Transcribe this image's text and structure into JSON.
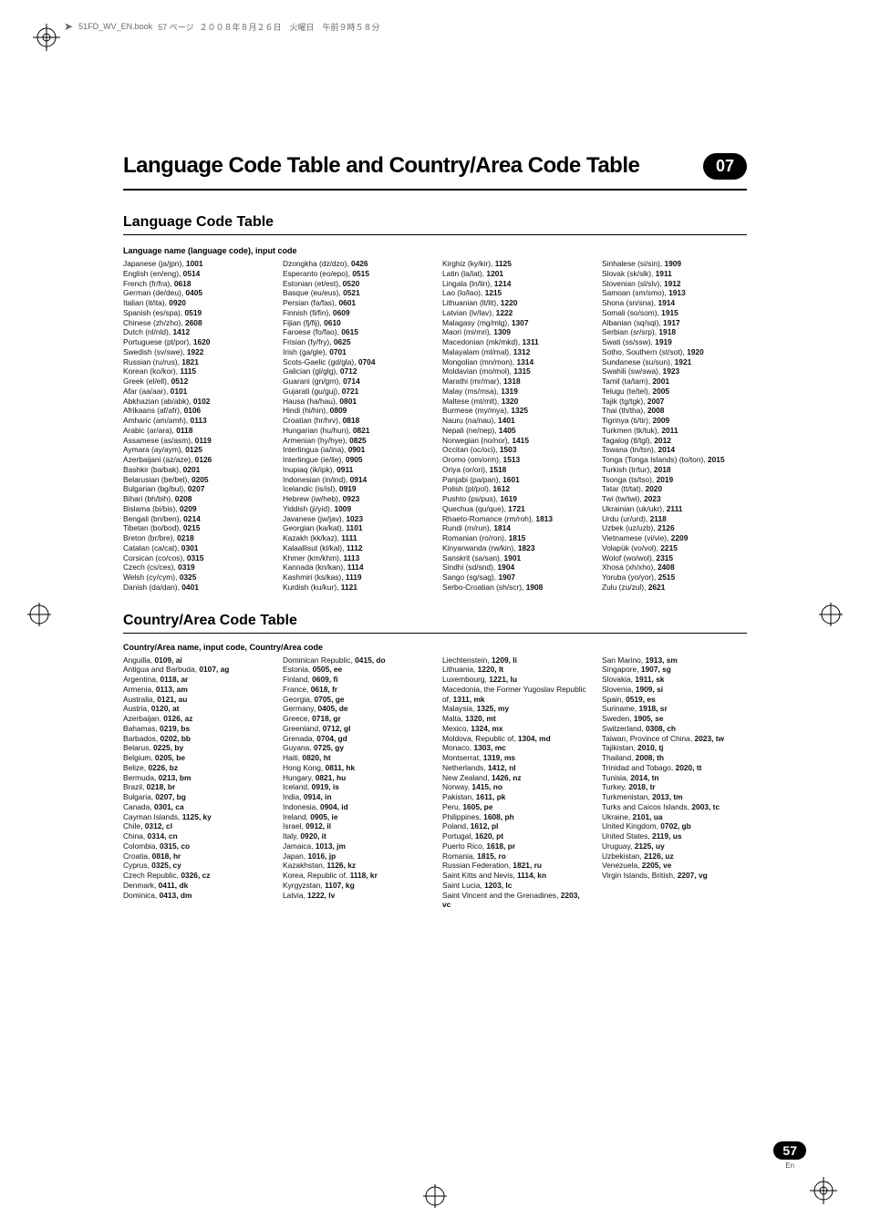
{
  "header_strip": {
    "filename": "51FD_WV_EN.book",
    "page_label": "57 ページ",
    "date_label": "２００８年８月２６日　火曜日　午前９時５８分"
  },
  "chapter": {
    "title": "Language Code Table and Country/Area Code Table",
    "number": "07"
  },
  "lang_section": {
    "heading": "Language Code Table",
    "label": "Language name (language code), input code",
    "cols": [
      [
        [
          "Japanese (ja/jpn)",
          "1001"
        ],
        [
          "English (en/eng)",
          "0514"
        ],
        [
          "French (fr/fra)",
          "0618"
        ],
        [
          "German (de/deu)",
          "0405"
        ],
        [
          "Italian (it/ita)",
          "0920"
        ],
        [
          "Spanish (es/spa)",
          "0519"
        ],
        [
          "Chinese (zh/zho)",
          "2608"
        ],
        [
          "Dutch (nl/nld)",
          "1412"
        ],
        [
          "Portuguese (pt/por)",
          "1620"
        ],
        [
          "Swedish (sv/swe)",
          "1922"
        ],
        [
          "Russian (ru/rus)",
          "1821"
        ],
        [
          "Korean (ko/kor)",
          "1115"
        ],
        [
          "Greek (el/ell)",
          "0512"
        ],
        [
          "Afar (aa/aar)",
          "0101"
        ],
        [
          "Abkhazian (ab/abk)",
          "0102"
        ],
        [
          "Afrikaans (af/afr)",
          "0106"
        ],
        [
          "Amharic (am/amh)",
          "0113"
        ],
        [
          "Arabic (ar/ara)",
          "0118"
        ],
        [
          "Assamese (as/asm)",
          "0119"
        ],
        [
          "Aymara (ay/aym)",
          "0125"
        ],
        [
          "Azerbaijani (az/aze)",
          "0126"
        ],
        [
          "Bashkir (ba/bak)",
          "0201"
        ],
        [
          "Belarusian (be/bel)",
          "0205"
        ],
        [
          "Bulgarian (bg/bul)",
          "0207"
        ],
        [
          "Bihari (bh/bih)",
          "0208"
        ],
        [
          "Bislama (bi/bis)",
          "0209"
        ],
        [
          "Bengali (bn/ben)",
          "0214"
        ],
        [
          "Tibetan (bo/bod)",
          "0215"
        ],
        [
          "Breton (br/bre)",
          "0218"
        ],
        [
          "Catalan (ca/cat)",
          "0301"
        ],
        [
          "Corsican (co/cos)",
          "0315"
        ],
        [
          "Czech (cs/ces)",
          "0319"
        ],
        [
          "Welsh (cy/cym)",
          "0325"
        ],
        [
          "Danish (da/dan)",
          "0401"
        ]
      ],
      [
        [
          "Dzongkha (dz/dzo)",
          "0426"
        ],
        [
          "Esperanto (eo/epo)",
          "0515"
        ],
        [
          "Estonian (et/est)",
          "0520"
        ],
        [
          "Basque (eu/eus)",
          "0521"
        ],
        [
          "Persian (fa/fas)",
          "0601"
        ],
        [
          "Finnish (fi/fin)",
          "0609"
        ],
        [
          "Fijian (fj/fij)",
          "0610"
        ],
        [
          "Faroese (fo/fao)",
          "0615"
        ],
        [
          "Frisian (fy/fry)",
          "0625"
        ],
        [
          "Irish (ga/gle)",
          "0701"
        ],
        [
          "Scots-Gaelic (gd/gla)",
          "0704"
        ],
        [
          "Galician (gl/glg)",
          "0712"
        ],
        [
          "Guarani (gn/grn)",
          "0714"
        ],
        [
          "Gujarati (gu/guj)",
          "0721"
        ],
        [
          "Hausa (ha/hau)",
          "0801"
        ],
        [
          "Hindi (hi/hin)",
          "0809"
        ],
        [
          "Croatian (hr/hrv)",
          "0818"
        ],
        [
          "Hungarian (hu/hun)",
          "0821"
        ],
        [
          "Armenian (hy/hye)",
          "0825"
        ],
        [
          "Interlingua (ia/ina)",
          "0901"
        ],
        [
          "Interlingue (ie/ile)",
          "0905"
        ],
        [
          "Inupiaq (ik/ipk)",
          "0911"
        ],
        [
          "Indonesian (in/ind)",
          "0914"
        ],
        [
          "Icelandic (is/isl)",
          "0919"
        ],
        [
          "Hebrew (iw/heb)",
          "0923"
        ],
        [
          "Yiddish (ji/yid)",
          "1009"
        ],
        [
          "Javanese (jw/jav)",
          "1023"
        ],
        [
          "Georgian (ka/kat)",
          "1101"
        ],
        [
          "Kazakh (kk/kaz)",
          "1111"
        ],
        [
          "Kalaallisut (kl/kal)",
          "1112"
        ],
        [
          "Khmer (km/khm)",
          "1113"
        ],
        [
          "Kannada (kn/kan)",
          "1114"
        ],
        [
          "Kashmiri (ks/kas)",
          "1119"
        ],
        [
          "Kurdish (ku/kur)",
          "1121"
        ]
      ],
      [
        [
          "Kirghiz (ky/kir)",
          "1125"
        ],
        [
          "Latin (la/lat)",
          "1201"
        ],
        [
          "Lingala (ln/lin)",
          "1214"
        ],
        [
          "Lao (lo/lao)",
          "1215"
        ],
        [
          "Lithuanian (lt/lit)",
          "1220"
        ],
        [
          "Latvian (lv/lav)",
          "1222"
        ],
        [
          "Malagasy (mg/mlg)",
          "1307"
        ],
        [
          "Maori (mi/mri)",
          "1309"
        ],
        [
          "Macedonian (mk/mkd)",
          "1311"
        ],
        [
          "Malayalam (ml/mal)",
          "1312"
        ],
        [
          "Mongolian (mn/mon)",
          "1314"
        ],
        [
          "Moldavian (mo/mol)",
          "1315"
        ],
        [
          "Marathi (mr/mar)",
          "1318"
        ],
        [
          "Malay (ms/msa)",
          "1319"
        ],
        [
          "Maltese (mt/mlt)",
          "1320"
        ],
        [
          "Burmese (my/mya)",
          "1325"
        ],
        [
          "Nauru (na/nau)",
          "1401"
        ],
        [
          "Nepali (ne/nep)",
          "1405"
        ],
        [
          "Norwegian (no/nor)",
          "1415"
        ],
        [
          "Occitan (oc/oci)",
          "1503"
        ],
        [
          "Oromo (om/orm)",
          "1513"
        ],
        [
          "Oriya (or/ori)",
          "1518"
        ],
        [
          "Panjabi (pa/pan)",
          "1601"
        ],
        [
          "Polish (pl/pol)",
          "1612"
        ],
        [
          "Pushto (ps/pus)",
          "1619"
        ],
        [
          "Quechua (qu/que)",
          "1721"
        ],
        [
          "Rhaeto-Romance (rm/roh)",
          "1813"
        ],
        [
          "Rundi (rn/run)",
          "1814"
        ],
        [
          "Romanian (ro/ron)",
          "1815"
        ],
        [
          "Kinyarwanda (rw/kin)",
          "1823"
        ],
        [
          "Sanskrit (sa/san)",
          "1901"
        ],
        [
          "Sindhi (sd/snd)",
          "1904"
        ],
        [
          "Sango (sg/sag)",
          "1907"
        ],
        [
          "Serbo-Croatian (sh/scr)",
          "1908"
        ]
      ],
      [
        [
          "Sinhalese (si/sin)",
          "1909"
        ],
        [
          "Slovak (sk/slk)",
          "1911"
        ],
        [
          "Slovenian (sl/slv)",
          "1912"
        ],
        [
          "Samoan (sm/smo)",
          "1913"
        ],
        [
          "Shona (sn/sna)",
          "1914"
        ],
        [
          "Somali (so/som)",
          "1915"
        ],
        [
          "Albanian (sq/sqi)",
          "1917"
        ],
        [
          "Serbian (sr/srp)",
          "1918"
        ],
        [
          "Swati (ss/ssw)",
          "1919"
        ],
        [
          "Sotho, Southern (st/sot)",
          "1920"
        ],
        [
          "Sundanese (su/sun)",
          "1921"
        ],
        [
          "Swahili (sw/swa)",
          "1923"
        ],
        [
          "Tamil (ta/tam)",
          "2001"
        ],
        [
          "Telugu (te/tel)",
          "2005"
        ],
        [
          "Tajik (tg/tgk)",
          "2007"
        ],
        [
          "Thai (th/tha)",
          "2008"
        ],
        [
          "Tigrinya (ti/tir)",
          "2009"
        ],
        [
          "Turkmen (tk/tuk)",
          "2011"
        ],
        [
          "Tagalog (tl/tgl)",
          "2012"
        ],
        [
          "Tswana (tn/tsn)",
          "2014"
        ],
        [
          "Tonga (Tonga Islands) (to/ton)",
          "2015"
        ],
        [
          "Turkish (tr/tur)",
          "2018"
        ],
        [
          "Tsonga (ts/tso)",
          "2019"
        ],
        [
          "Tatar (tt/tat)",
          "2020"
        ],
        [
          "Twi (tw/twi)",
          "2023"
        ],
        [
          "Ukrainian (uk/ukr)",
          "2111"
        ],
        [
          "Urdu (ur/urd)",
          "2118"
        ],
        [
          "Uzbek (uz/uzb)",
          "2126"
        ],
        [
          "Vietnamese (vi/vie)",
          "2209"
        ],
        [
          "Volapük (vo/vol)",
          "2215"
        ],
        [
          "Wolof (wo/wol)",
          "2315"
        ],
        [
          "Xhosa (xh/xho)",
          "2408"
        ],
        [
          "Yoruba (yo/yor)",
          "2515"
        ],
        [
          "Zulu (zu/zul)",
          "2621"
        ]
      ]
    ]
  },
  "country_section": {
    "heading": "Country/Area Code Table",
    "label": "Country/Area name, input code, Country/Area code",
    "cols": [
      [
        [
          "Anguilla",
          "0109, ai"
        ],
        [
          "Antigua and Barbuda",
          "0107, ag"
        ],
        [
          "Argentina",
          "0118, ar"
        ],
        [
          "Armenia",
          "0113, am"
        ],
        [
          "Australia",
          "0121, au"
        ],
        [
          "Austria",
          "0120, at"
        ],
        [
          "Azerbaijan",
          "0126, az"
        ],
        [
          "Bahamas",
          "0219, bs"
        ],
        [
          "Barbados",
          "0202, bb"
        ],
        [
          "Belarus",
          "0225, by"
        ],
        [
          "Belgium",
          "0205, be"
        ],
        [
          "Belize",
          "0226, bz"
        ],
        [
          "Bermuda",
          "0213, bm"
        ],
        [
          "Brazil",
          "0218, br"
        ],
        [
          "Bulgaria",
          "0207, bg"
        ],
        [
          "Canada",
          "0301, ca"
        ],
        [
          "Cayman Islands",
          "1125, ky"
        ],
        [
          "Chile",
          "0312, cl"
        ],
        [
          "China",
          "0314, cn"
        ],
        [
          "Colombia",
          "0315, co"
        ],
        [
          "Croatia",
          "0818, hr"
        ],
        [
          "Cyprus",
          "0325, cy"
        ],
        [
          "Czech Republic",
          "0326, cz"
        ],
        [
          "Denmark",
          "0411, dk"
        ],
        [
          "Dominica",
          "0413, dm"
        ]
      ],
      [
        [
          "Dominican Republic",
          "0415, do"
        ],
        [
          "Estonia",
          "0505, ee"
        ],
        [
          "Finland",
          "0609, fi"
        ],
        [
          "France",
          "0618, fr"
        ],
        [
          "Georgia",
          "0705, ge"
        ],
        [
          "Germany",
          "0405, de"
        ],
        [
          "Greece",
          "0718, gr"
        ],
        [
          "Greenland",
          "0712, gl"
        ],
        [
          "Grenada",
          "0704, gd"
        ],
        [
          "Guyana",
          "0725, gy"
        ],
        [
          "Haiti",
          "0820, ht"
        ],
        [
          "Hong Kong",
          "0811, hk"
        ],
        [
          "Hungary",
          "0821, hu"
        ],
        [
          "Iceland",
          "0919, is"
        ],
        [
          "India",
          "0914, in"
        ],
        [
          "Indonesia",
          "0904, id"
        ],
        [
          "Ireland",
          "0905, ie"
        ],
        [
          "Israel",
          "0912, il"
        ],
        [
          "Italy",
          "0920, it"
        ],
        [
          "Jamaica",
          "1013, jm"
        ],
        [
          "Japan",
          "1016, jp"
        ],
        [
          "Kazakhstan",
          "1126, kz"
        ],
        [
          "Korea, Republic of",
          "1118, kr"
        ],
        [
          "Kyrgyzstan",
          "1107, kg"
        ],
        [
          "Latvia",
          "1222, lv"
        ]
      ],
      [
        [
          "Liechtenstein",
          "1209, li"
        ],
        [
          "Lithuania",
          "1220, lt"
        ],
        [
          "Luxembourg",
          "1221, lu"
        ],
        [
          "Macedonia, the Former Yugoslav Republic of",
          "1311, mk"
        ],
        [
          "Malaysia",
          "1325, my"
        ],
        [
          "Malta",
          "1320, mt"
        ],
        [
          "Mexico",
          "1324, mx"
        ],
        [
          "Moldova, Republic of",
          "1304, md"
        ],
        [
          "Monaco",
          "1303, mc"
        ],
        [
          "Montserrat",
          "1319, ms"
        ],
        [
          "Netherlands",
          "1412, nl"
        ],
        [
          "New Zealand",
          "1426, nz"
        ],
        [
          "Norway",
          "1415, no"
        ],
        [
          "Pakistan",
          "1611, pk"
        ],
        [
          "Peru",
          "1605, pe"
        ],
        [
          "Philippines",
          "1608, ph"
        ],
        [
          "Poland",
          "1612, pl"
        ],
        [
          "Portugal",
          "1620, pt"
        ],
        [
          "Puerto Rico",
          "1618, pr"
        ],
        [
          "Romania",
          "1815, ro"
        ],
        [
          "Russian Federation",
          "1821, ru"
        ],
        [
          "Saint Kitts and Nevis",
          "1114, kn"
        ],
        [
          "Saint Lucia",
          "1203, lc"
        ],
        [
          "Saint Vincent and the Grenadines",
          "2203, vc"
        ]
      ],
      [
        [
          "San Marino",
          "1913, sm"
        ],
        [
          "Singapore",
          "1907, sg"
        ],
        [
          "Slovakia",
          "1911, sk"
        ],
        [
          "Slovenia",
          "1909, si"
        ],
        [
          "Spain",
          "0519, es"
        ],
        [
          "Suriname",
          "1918, sr"
        ],
        [
          "Sweden",
          "1905, se"
        ],
        [
          "Switzerland",
          "0308, ch"
        ],
        [
          "Taiwan, Province of China",
          "2023, tw"
        ],
        [
          "Tajikistan",
          "2010, tj"
        ],
        [
          "Thailand",
          "2008, th"
        ],
        [
          "Trinidad and Tobago",
          "2020, tt"
        ],
        [
          "Tunisia",
          "2014, tn"
        ],
        [
          "Turkey",
          "2018, tr"
        ],
        [
          "Turkmenistan",
          "2013, tm"
        ],
        [
          "Turks and Caicos Islands",
          "2003, tc"
        ],
        [
          "Ukraine",
          "2101, ua"
        ],
        [
          "United Kingdom",
          "0702, gb"
        ],
        [
          "United States",
          "2119, us"
        ],
        [
          "Uruguay",
          "2125, uy"
        ],
        [
          "Uzbekistan",
          "2126, uz"
        ],
        [
          "Venezuela",
          "2205, ve"
        ],
        [
          "Virgin Islands, British",
          "2207, vg"
        ]
      ]
    ]
  },
  "page": {
    "number": "57",
    "lang": "En"
  }
}
